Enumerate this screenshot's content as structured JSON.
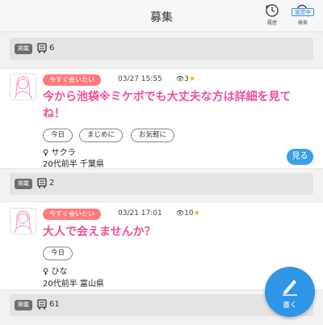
{
  "header": {
    "title": "募集",
    "history_label": "履歴",
    "search_label": "検索",
    "setting_badge": "設定中"
  },
  "posts_bar_tag": "掲載",
  "bars": [
    {
      "count": "6"
    },
    {
      "count": "2"
    },
    {
      "count": "61"
    }
  ],
  "posts": [
    {
      "label": "今すぐ会いたい",
      "datetime": "03/27 15:55",
      "views": "3",
      "title_line1": "今から池袋※ミケボでも大丈夫な方は詳細を見て",
      "title_line2": "ね！",
      "tags": [
        "今日",
        "まじめに",
        "お気軽に"
      ],
      "name": "♀ サクラ",
      "info": "20代前半 千葉県",
      "view_button": "見る"
    },
    {
      "label": "今すぐ会いたい",
      "datetime": "03/21 17:01",
      "views": "10",
      "title_line1": "大人で会えませんか？",
      "tags": [
        "今日"
      ],
      "name": "♀ ひな",
      "info": "20代前半 富山県"
    }
  ],
  "fab": {
    "label": "書く"
  },
  "colors": {
    "accent_pink": "#f04f9a",
    "label_red": "#ff7b7b",
    "button_blue": "#3aa0e8"
  }
}
